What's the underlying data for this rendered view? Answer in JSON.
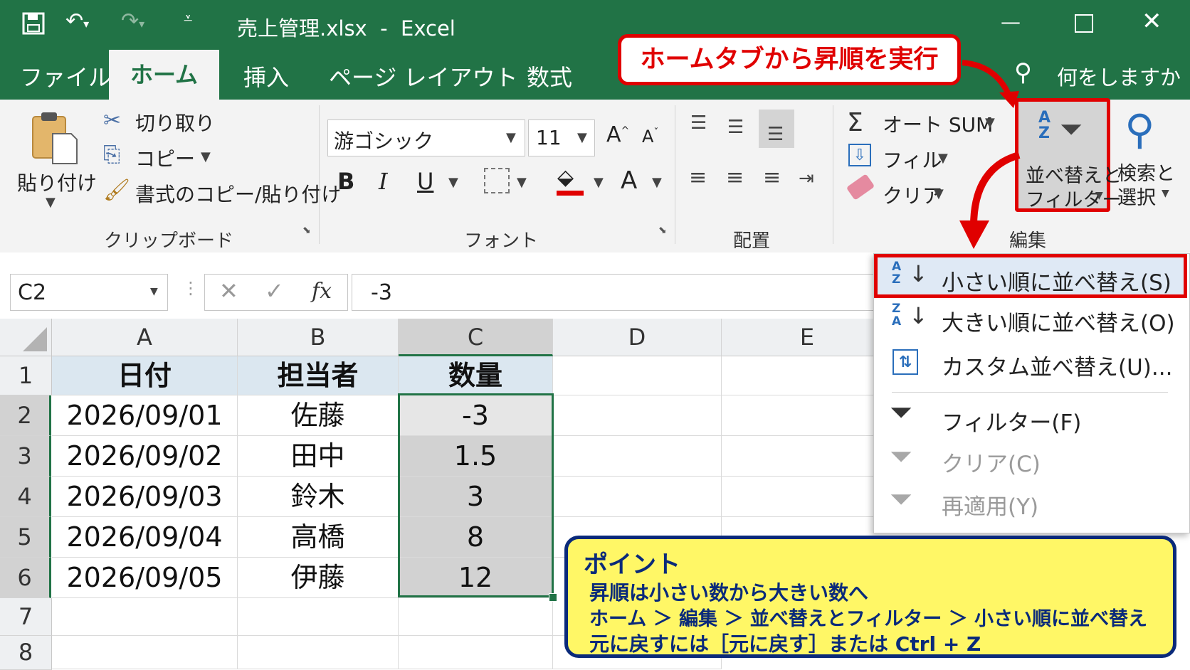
{
  "window": {
    "title": "売上管理.xlsx  -  Excel"
  },
  "tabs": [
    "ファイル",
    "ホーム",
    "挿入",
    "ページ レイアウト",
    "数式"
  ],
  "tell_me": "何をしますか",
  "clipboard": {
    "paste": "貼り付け",
    "cut": "切り取り",
    "copy": "コピー",
    "format_painter": "書式のコピー/貼り付け",
    "group": "クリップボード"
  },
  "font": {
    "name": "游ゴシック",
    "size": "11",
    "group": "フォント",
    "bold": "B",
    "italic": "I",
    "underline": "U",
    "grow": "A",
    "shrink": "A",
    "color_a": "A"
  },
  "alignment": {
    "group": "配置"
  },
  "editing": {
    "autosum": "オート SUM",
    "fill": "フィル",
    "clear": "クリア",
    "sort_filter_l1": "並べ替えと",
    "sort_filter_l2": "フィルター",
    "find_l1": "検索と",
    "find_l2": "選択",
    "group": "編集"
  },
  "formula_bar": {
    "name_box": "C2",
    "fx": "fx",
    "value": "-3"
  },
  "columns": [
    "A",
    "B",
    "C",
    "D",
    "E"
  ],
  "rows": [
    "1",
    "2",
    "3",
    "4",
    "5",
    "6",
    "7",
    "8"
  ],
  "table": {
    "headers": [
      "日付",
      "担当者",
      "数量"
    ],
    "data": [
      [
        "2026/09/01",
        "佐藤",
        "-3"
      ],
      [
        "2026/09/02",
        "田中",
        "1.5"
      ],
      [
        "2026/09/03",
        "鈴木",
        "3"
      ],
      [
        "2026/09/04",
        "高橋",
        "8"
      ],
      [
        "2026/09/05",
        "伊藤",
        "12"
      ]
    ]
  },
  "menu": {
    "items": [
      {
        "label": "小さい順に並べ替え(S)",
        "icon": "sort-ascending-icon",
        "enabled": true
      },
      {
        "label": "大きい順に並べ替え(O)",
        "icon": "sort-descending-icon",
        "enabled": true
      },
      {
        "label": "カスタム並べ替え(U)...",
        "icon": "custom-sort-icon",
        "enabled": true
      },
      {
        "label": "フィルター(F)",
        "icon": "filter-icon",
        "enabled": true
      },
      {
        "label": "クリア(C)",
        "icon": "clear-filter-icon",
        "enabled": false
      },
      {
        "label": "再適用(Y)",
        "icon": "reapply-icon",
        "enabled": false
      }
    ]
  },
  "callout": "ホームタブから昇順を実行",
  "point": {
    "title": "ポイント",
    "line1": "昇順は小さい数から大きい数へ",
    "line2": "ホーム ＞ 編集 ＞ 並べ替えとフィルター ＞ 小さい順に並べ替え",
    "line3": "元に戻すには［元に戻す］または Ctrl + Z"
  },
  "colors": {
    "excel_green": "#217346",
    "highlight_red": "#e00000",
    "point_yellow": "#fff766",
    "point_navy": "#0a2a7a"
  }
}
